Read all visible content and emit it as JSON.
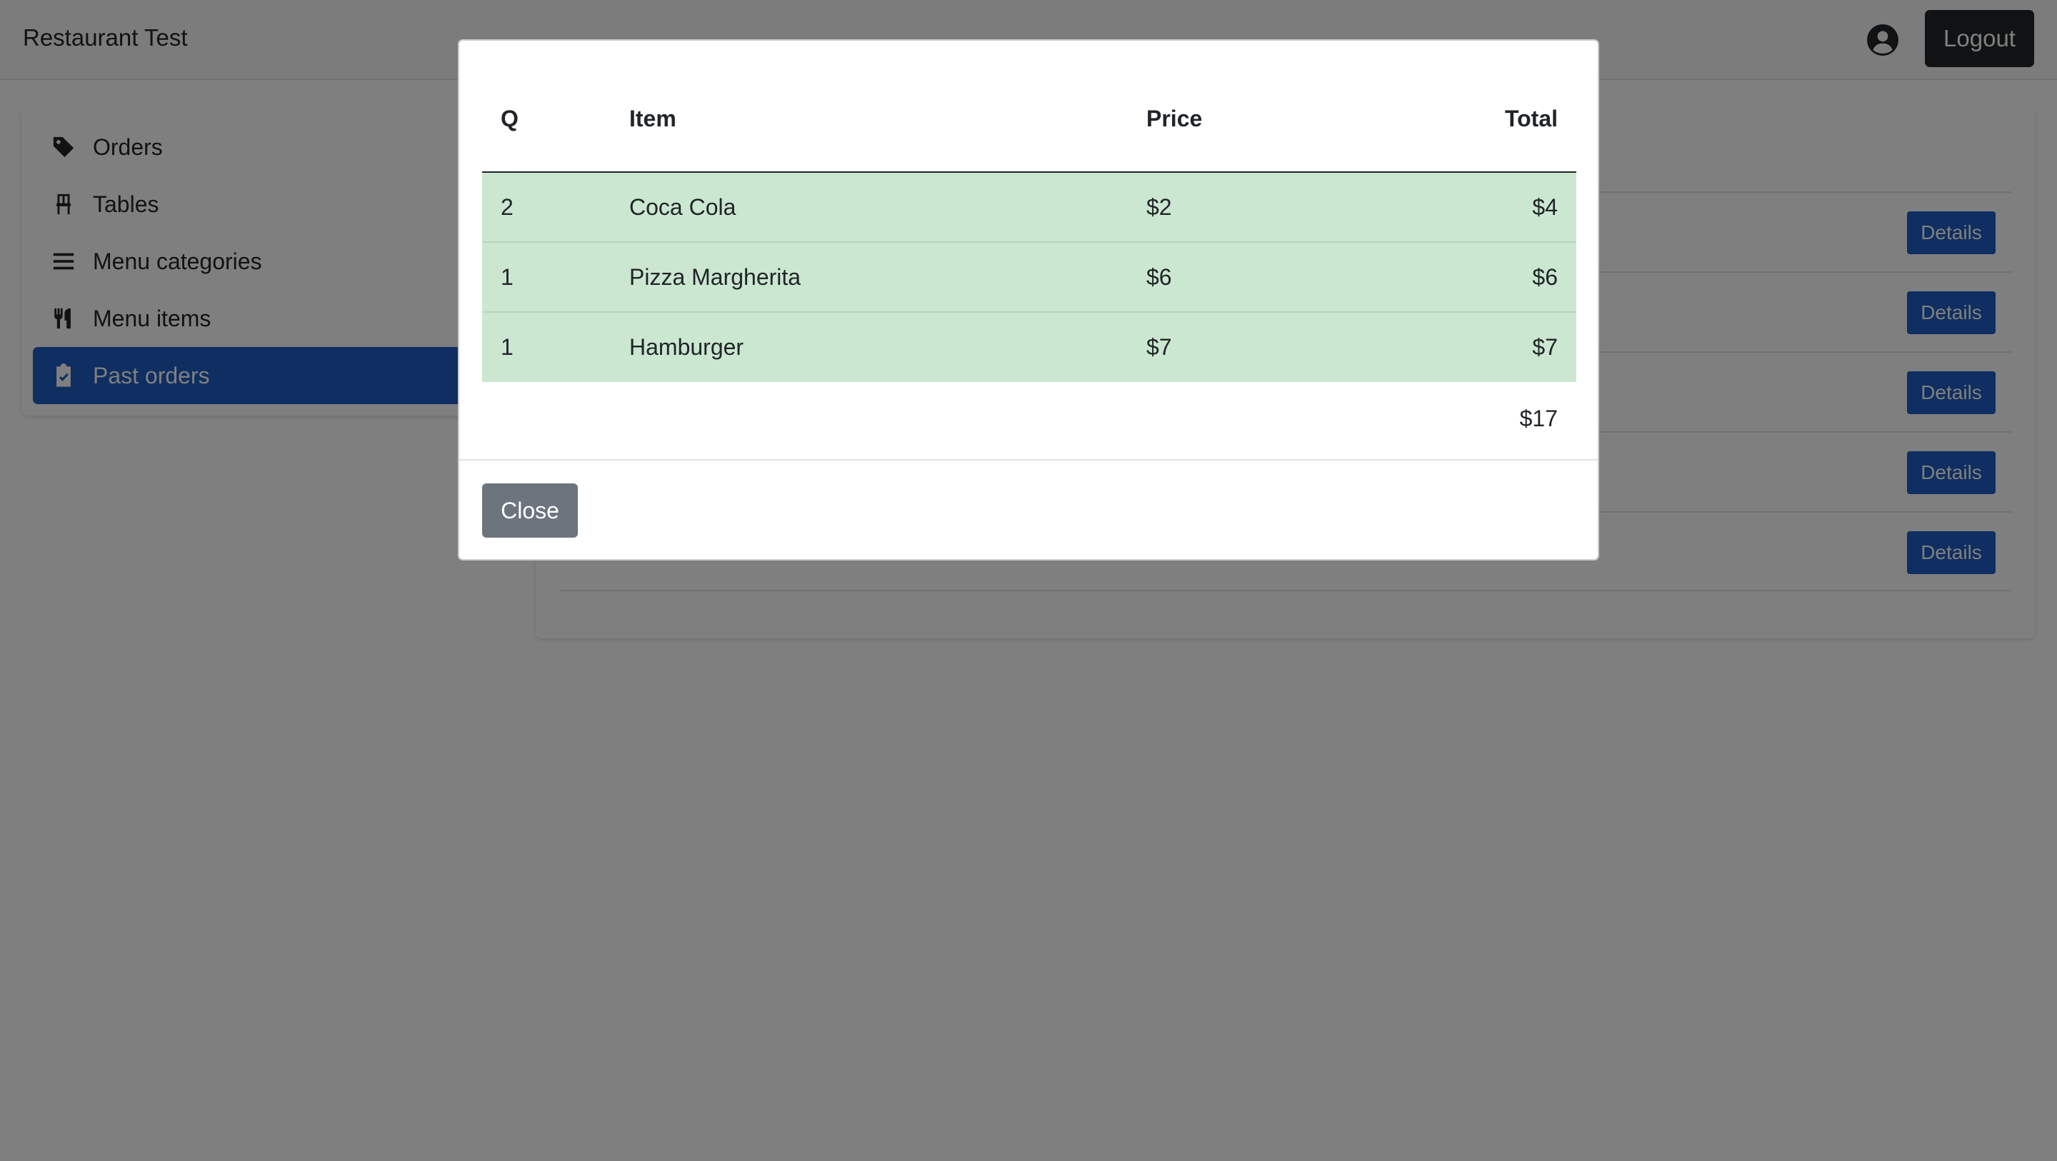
{
  "navbar": {
    "brand": "Restaurant Test",
    "logout_label": "Logout"
  },
  "sidebar": {
    "items": [
      {
        "label": "Orders",
        "icon": "tag-icon"
      },
      {
        "label": "Tables",
        "icon": "chair-icon"
      },
      {
        "label": "Menu categories",
        "icon": "list-icon"
      },
      {
        "label": "Menu items",
        "icon": "utensils-icon"
      },
      {
        "label": "Past orders",
        "icon": "clipboard-check-icon",
        "active": true
      }
    ]
  },
  "past_orders": {
    "details_label": "Details"
  },
  "modal": {
    "headers": {
      "q": "Q",
      "item": "Item",
      "price": "Price",
      "total": "Total"
    },
    "rows": [
      {
        "q": "2",
        "item": "Coca Cola",
        "price": "$2",
        "total": "$4"
      },
      {
        "q": "1",
        "item": "Pizza Margherita",
        "price": "$6",
        "total": "$6"
      },
      {
        "q": "1",
        "item": "Hamburger",
        "price": "$7",
        "total": "$7"
      }
    ],
    "grand_total": "$17",
    "close_label": "Close"
  },
  "colors": {
    "primary": "#1f5dc2",
    "row_highlight": "#cbe7d1",
    "dark": "#212529",
    "secondary": "#6c757d"
  }
}
